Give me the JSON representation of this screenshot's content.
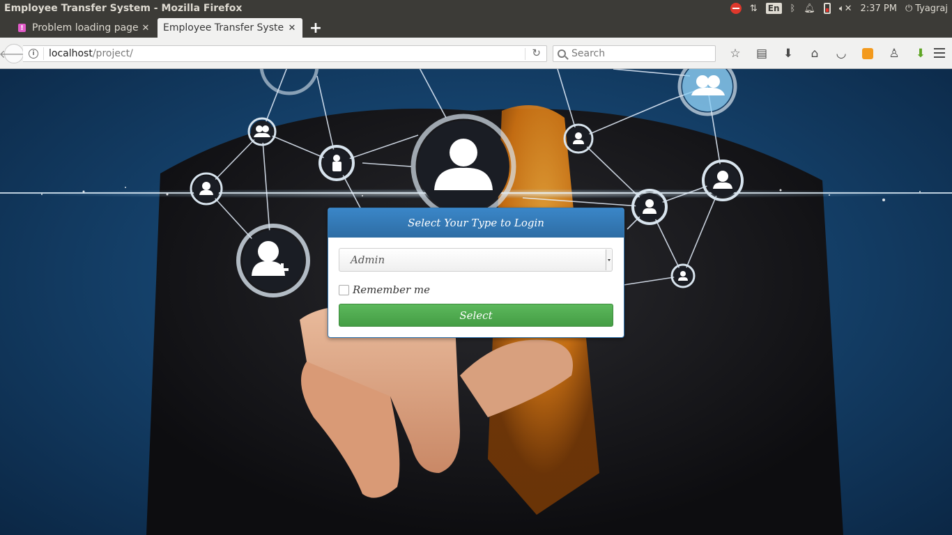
{
  "os": {
    "window_title": "Employee Transfer System - Mozilla Firefox",
    "input_lang": "En",
    "clock": "2:37 PM",
    "user": "Tyagraj"
  },
  "tabs": [
    {
      "label": "Problem loading page",
      "active": false,
      "icon": "warning-icon"
    },
    {
      "label": "Employee Transfer System",
      "active": true
    }
  ],
  "navbar": {
    "url_host": "localhost",
    "url_path": "/project/",
    "search_placeholder": "Search"
  },
  "login": {
    "heading": "Select Your Type to Login",
    "selected_type": "Admin",
    "remember_label": "Remember me",
    "remember_checked": false,
    "submit_label": "Select"
  },
  "colors": {
    "panel_heading": "#337ab7",
    "submit_button": "#5cb85c",
    "os_bar": "#3c3b37"
  }
}
